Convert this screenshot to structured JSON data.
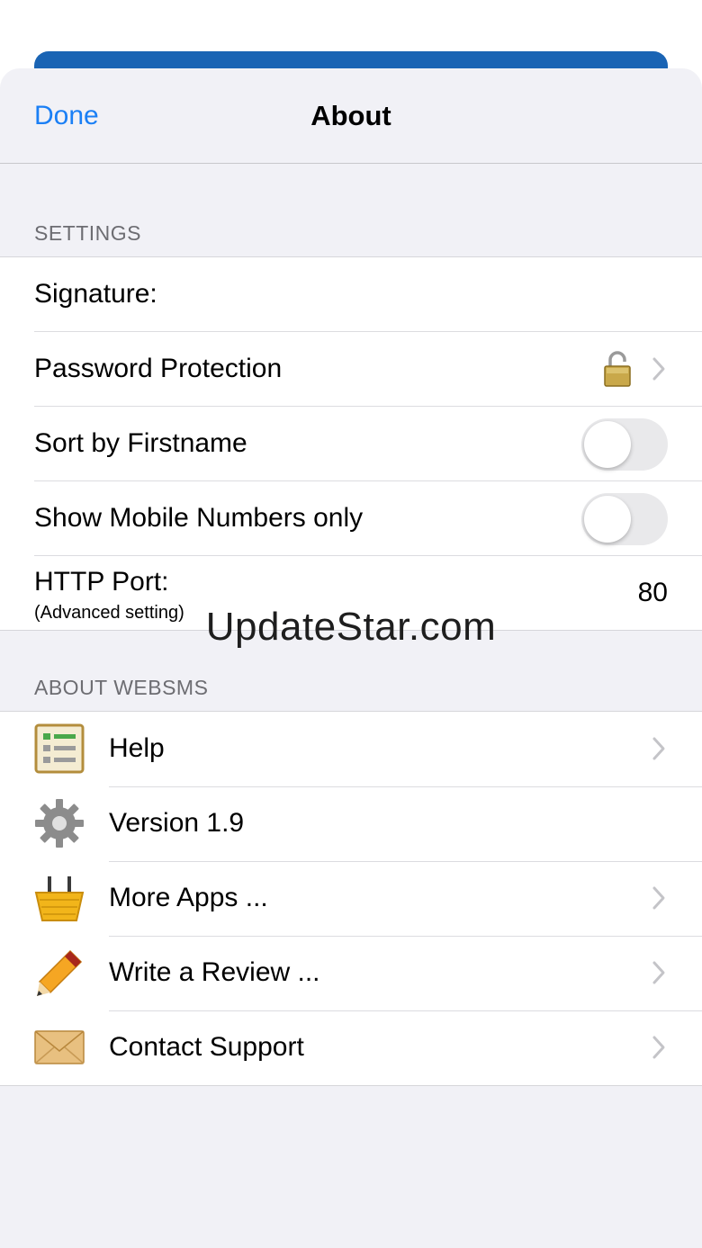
{
  "nav": {
    "done_label": "Done",
    "title": "About"
  },
  "settings": {
    "header": "SETTINGS",
    "signature_label": "Signature:",
    "password_label": "Password Protection",
    "sort_label": "Sort by Firstname",
    "sort_on": false,
    "mobile_label": "Show Mobile Numbers only",
    "mobile_on": false,
    "port_label": "HTTP Port:",
    "port_sub": "(Advanced setting)",
    "port_value": "80"
  },
  "about": {
    "header": "ABOUT WEBSMS",
    "items": [
      {
        "label": "Help",
        "icon": "help-list-icon",
        "chevron": true
      },
      {
        "label": "Version 1.9",
        "icon": "gear-icon",
        "chevron": false
      },
      {
        "label": "More Apps ...",
        "icon": "basket-icon",
        "chevron": true
      },
      {
        "label": "Write a Review ...",
        "icon": "pencil-icon",
        "chevron": true
      },
      {
        "label": "Contact Support",
        "icon": "envelope-icon",
        "chevron": true
      }
    ]
  },
  "watermark": "UpdateStar.com",
  "colors": {
    "accent": "#1a7ff5",
    "header_bar": "#1a64b4",
    "background": "#f1f1f6"
  }
}
